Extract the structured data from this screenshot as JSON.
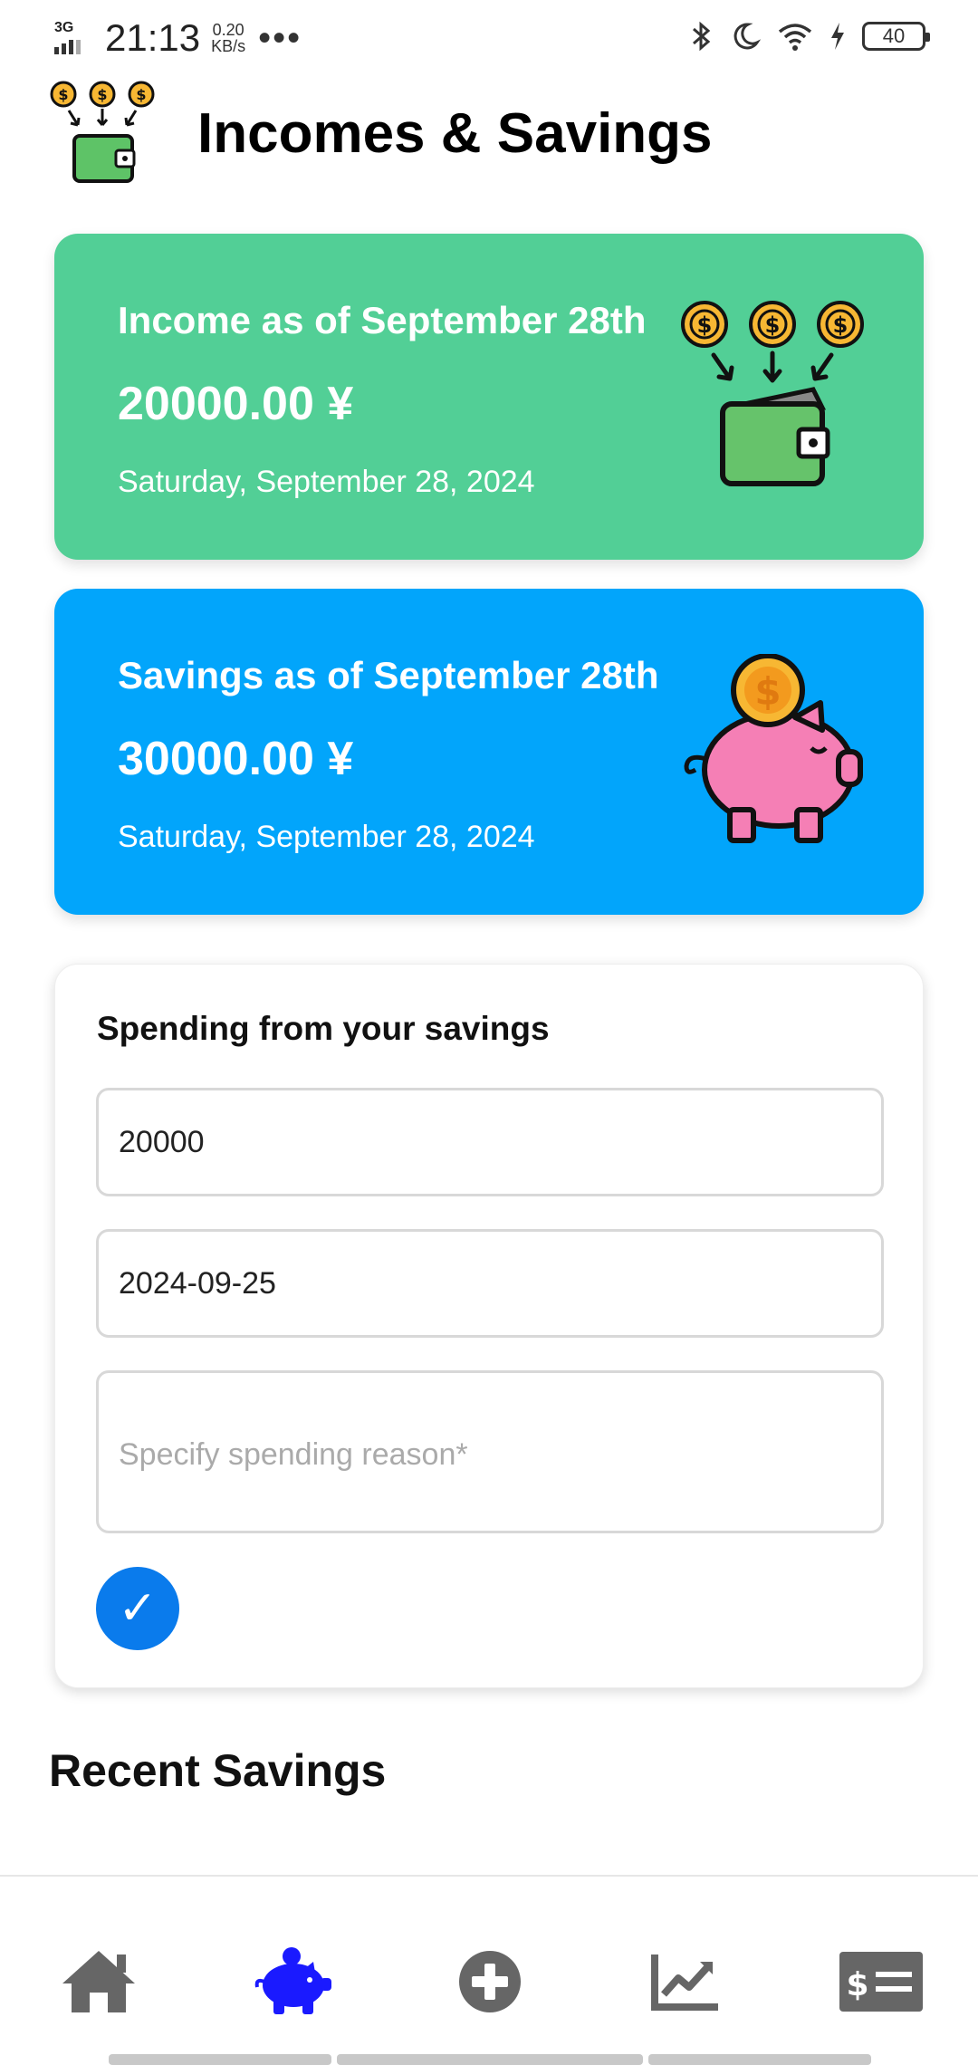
{
  "status_bar": {
    "network": "3G",
    "time": "21:13",
    "speed_value": "0.20",
    "speed_unit": "KB/s",
    "battery": "40"
  },
  "header": {
    "title": "Incomes & Savings"
  },
  "income_card": {
    "title": "Income as of September 28th",
    "amount": "20000.00 ¥",
    "date": "Saturday, September 28, 2024",
    "color": "#52cf96"
  },
  "savings_card": {
    "title": "Savings as of September 28th",
    "amount": "30000.00 ¥",
    "date": "Saturday, September 28, 2024",
    "color": "#02a5fb"
  },
  "spending_form": {
    "title": "Spending from your savings",
    "amount_value": "20000",
    "date_value": "2024-09-25",
    "reason_placeholder": "Specify spending reason*",
    "submit_label": "✓"
  },
  "recent": {
    "title": "Recent Savings"
  },
  "nav": {
    "items": [
      {
        "icon": "home-icon",
        "active": false
      },
      {
        "icon": "piggy-bank-icon",
        "active": true
      },
      {
        "icon": "add-circle-icon",
        "active": false
      },
      {
        "icon": "chart-line-icon",
        "active": false
      },
      {
        "icon": "money-bill-icon",
        "active": false
      }
    ],
    "active_color": "#1a1aff",
    "inactive_color": "#666666"
  }
}
